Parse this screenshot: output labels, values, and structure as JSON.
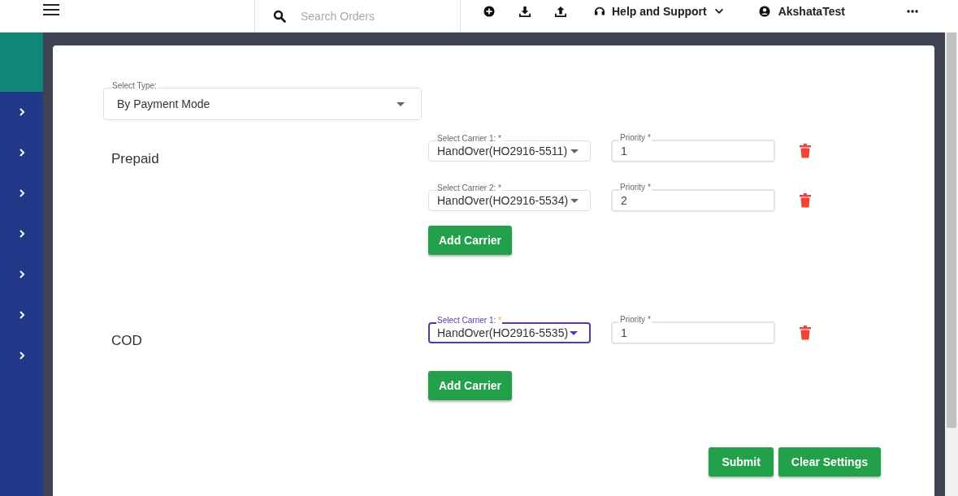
{
  "topbar": {
    "search": {
      "placeholder": "Search Orders"
    },
    "help": "Help and Support",
    "user": "AkshataTest"
  },
  "sidebar": {
    "items": [
      {
        "expanded": false
      },
      {
        "expanded": false
      },
      {
        "expanded": false
      },
      {
        "expanded": false
      },
      {
        "expanded": false
      },
      {
        "expanded": false
      },
      {
        "expanded": false
      }
    ]
  },
  "select_type": {
    "label": "Select Type:",
    "value": "By Payment Mode"
  },
  "groups": [
    {
      "name": "Prepaid",
      "carriers": [
        {
          "label": "Select Carrier 1:",
          "required": "*",
          "value": "HandOver(HO2916-5511)",
          "focused": false,
          "priority_label": "Priority *",
          "priority": "1"
        },
        {
          "label": "Select Carrier 2:",
          "required": "*",
          "value": "HandOver(HO2916-5534)",
          "focused": false,
          "priority_label": "Priority *",
          "priority": "2"
        }
      ],
      "add_button": "Add Carrier"
    },
    {
      "name": "COD",
      "carriers": [
        {
          "label": "Select Carrier 1:",
          "required": "*",
          "value": "HandOver(HO2916-5535)",
          "focused": true,
          "priority_label": "Priority *",
          "priority": "1"
        }
      ],
      "add_button": "Add Carrier"
    }
  ],
  "buttons": [
    "Submit",
    "Clear Settings"
  ]
}
